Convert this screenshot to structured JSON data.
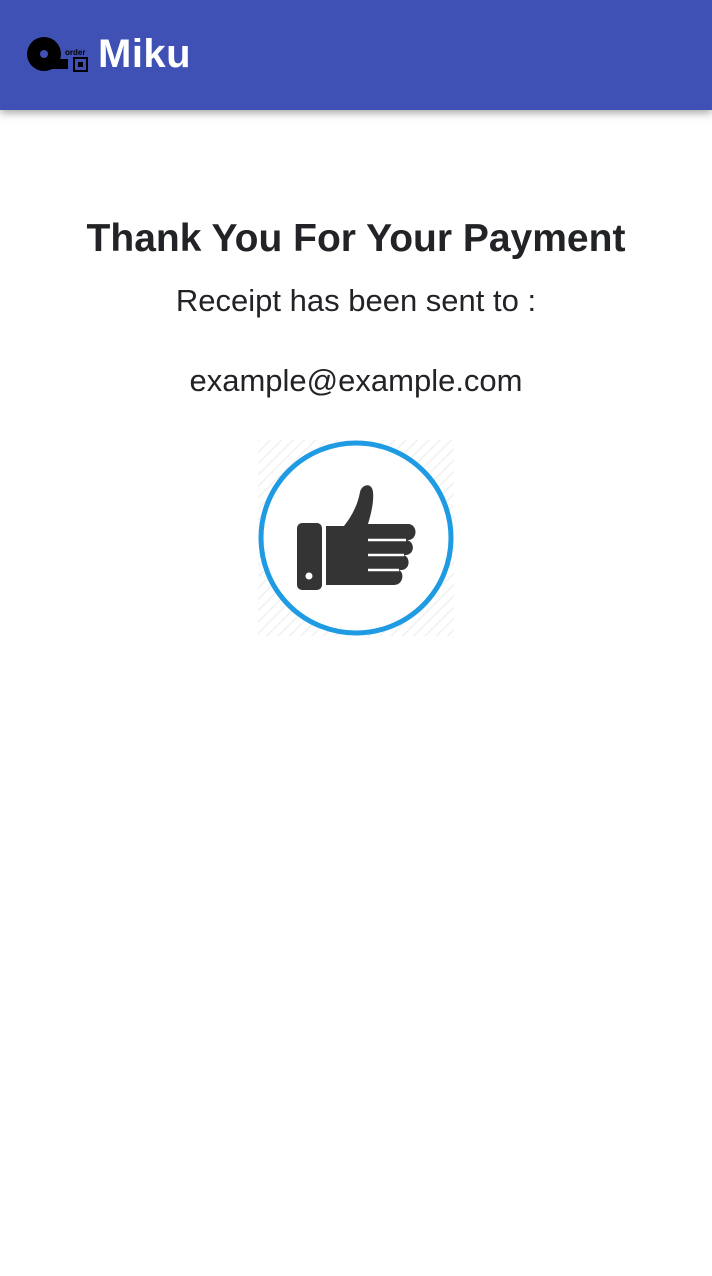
{
  "app_bar": {
    "title": "Miku",
    "logo_text": "order",
    "color": "#3F51B5"
  },
  "confirmation": {
    "headline": "Thank You For Your Payment",
    "subline": "Receipt has been sent to :",
    "email": "example@example.com",
    "icon": "thumbs-up-icon",
    "ring_color": "#1E9BE3"
  }
}
